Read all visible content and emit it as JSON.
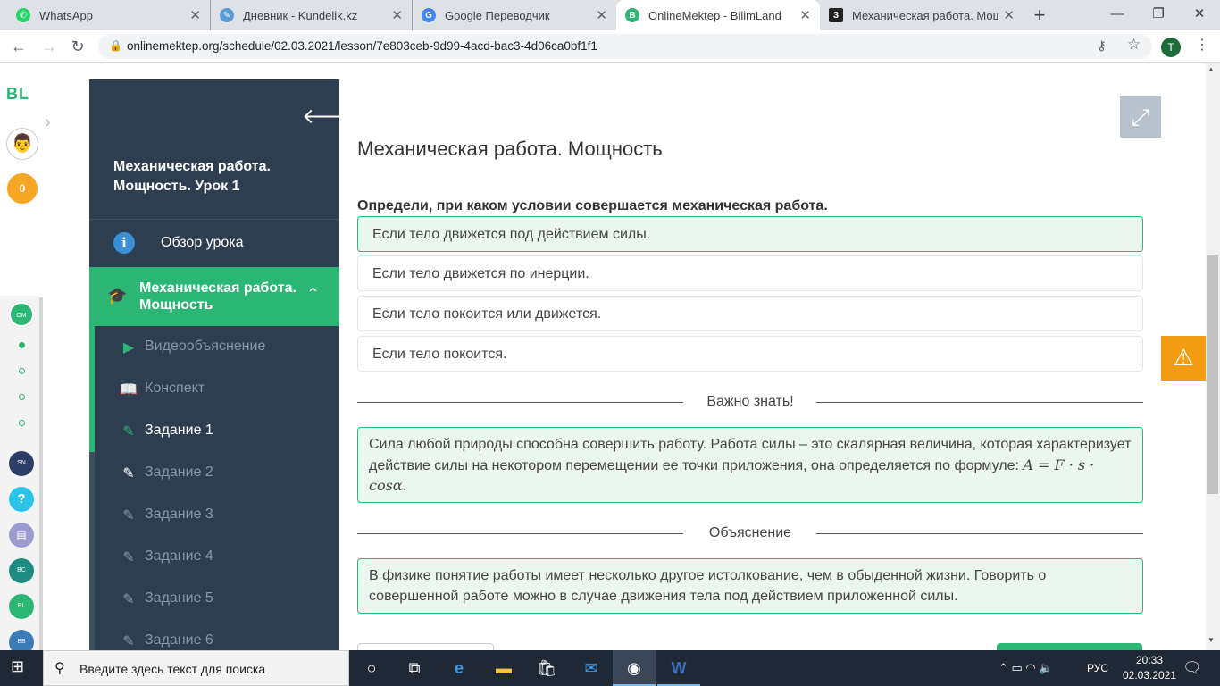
{
  "browser": {
    "tabs": [
      {
        "title": "WhatsApp",
        "icon": "whatsapp-icon",
        "color": "#25d366",
        "glyph": "✆"
      },
      {
        "title": "Дневник - Kundelik.kz",
        "icon": "kundelik-icon",
        "color": "#5b9bd5",
        "glyph": "✎"
      },
      {
        "title": "Google Переводчик",
        "icon": "google-translate-icon",
        "color": "#4285f4",
        "glyph": "G"
      },
      {
        "title": "OnlineMektep - BilimLand",
        "icon": "bilimland-icon",
        "color": "#2bb673",
        "glyph": "B"
      },
      {
        "title": "Механическая работа. Мощн",
        "icon": "znanija-icon",
        "color": "#222222",
        "glyph": "З"
      }
    ],
    "new_tab": "+",
    "url": "onlinemektep.org/schedule/02.03.2021/lesson/7e803ceb-9d99-4acd-bac3-4d06ca0bf1f1",
    "profile_initial": "T"
  },
  "rail": {
    "logo": "BL",
    "coins": "0"
  },
  "sidebar": {
    "title": "Механическая работа. Мощность. Урок 1",
    "overview": "Обзор урока",
    "active_section": "Механическая работа. Мощность",
    "items": [
      {
        "label": "Видеообъяснение",
        "icon": "play-icon",
        "glyph": "▶",
        "color": "#2bb673",
        "text_color": "#8a97a5"
      },
      {
        "label": "Конспект",
        "icon": "book-icon",
        "glyph": "📖",
        "color": "#2bb673",
        "text_color": "#8a97a5"
      },
      {
        "label": "Задание 1",
        "icon": "edit-icon",
        "glyph": "✎",
        "color": "#2bb673",
        "text_color": "#ffffff"
      },
      {
        "label": "Задание 2",
        "icon": "edit-icon",
        "glyph": "✎",
        "color": "#ffffff",
        "text_color": "#8a97a5"
      },
      {
        "label": "Задание 3",
        "icon": "edit-icon",
        "glyph": "✎",
        "color": "#8a97a5",
        "text_color": "#8a97a5"
      },
      {
        "label": "Задание 4",
        "icon": "edit-icon",
        "glyph": "✎",
        "color": "#8a97a5",
        "text_color": "#8a97a5"
      },
      {
        "label": "Задание 5",
        "icon": "edit-icon",
        "glyph": "✎",
        "color": "#8a97a5",
        "text_color": "#8a97a5"
      },
      {
        "label": "Задание 6",
        "icon": "edit-icon",
        "glyph": "✎",
        "color": "#8a97a5",
        "text_color": "#8a97a5"
      }
    ]
  },
  "content": {
    "title": "Механическая работа. Мощность",
    "question": "Определи, при каком условии совершается механическая работа.",
    "options": [
      "Если тело движется под действием силы.",
      "Если тело движется по инерции.",
      "Если тело покоится или движется.",
      "Если тело покоится."
    ],
    "selected_option_index": 0,
    "important_heading": "Важно знать!",
    "important_text": "Сила любой природы способна совершить работу. Работа силы – это скалярная величина, которая характеризует действие силы на некотором перемещении ее точки приложения, она определяется по формуле: ",
    "important_formula": "A = F · s · cosα.",
    "explanation_heading": "Объяснение",
    "explanation_text": "В физике понятие работы имеет несколько другое истолкование, чем в обыденной жизни. Говорить о совершенной работе можно в случае движения тела под действием приложенной силы."
  },
  "taskbar": {
    "search_placeholder": "Введите здесь текст для поиска",
    "language": "РУС",
    "time": "20:33",
    "date": "02.03.2021"
  },
  "colors": {
    "accent": "#2bb673",
    "sidebar_bg": "#2c3e50",
    "warning": "#f39c12"
  }
}
